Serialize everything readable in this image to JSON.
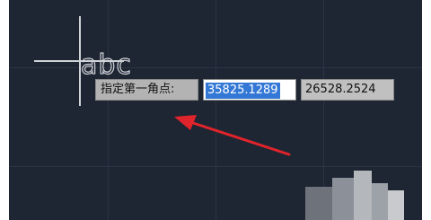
{
  "prompt": {
    "label": "指定第一角点:"
  },
  "coordinate_input": {
    "x_value": "35825.1289",
    "y_value": "26528.2524"
  },
  "cursor_text": "abc",
  "colors": {
    "canvas": "#1e2533",
    "grid": "#2c3444",
    "crosshair": "#cfd3d8",
    "selection": "#3478d6",
    "annotation_arrow": "#e0242b"
  },
  "icons": {
    "crosshair": "crosshair-cursor-icon",
    "arrow": "red-pointer-arrow-icon"
  }
}
